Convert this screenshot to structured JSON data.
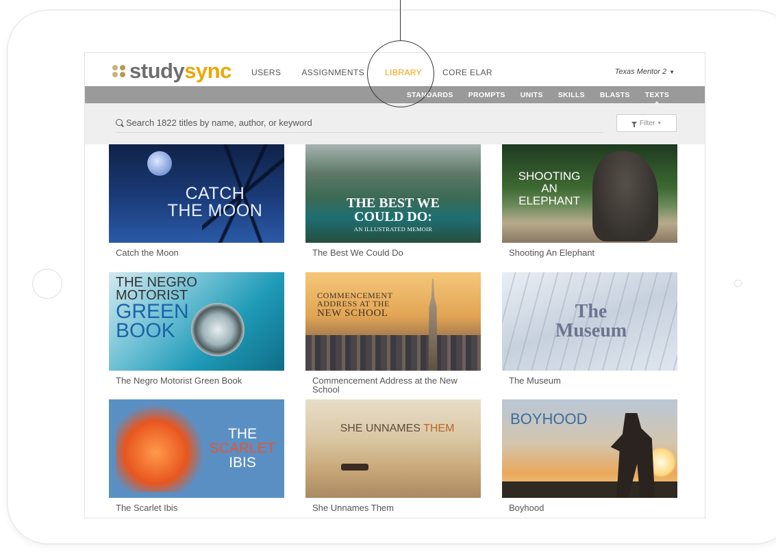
{
  "app": {
    "logo": {
      "prefix": "study",
      "suffix": "sync"
    },
    "nav": [
      "USERS",
      "ASSIGNMENTS",
      "LIBRARY",
      "CORE ELAR"
    ],
    "active_nav": "LIBRARY",
    "user_menu": "Texas Mentor 2",
    "subnav": [
      "STANDARDS",
      "PROMPTS",
      "UNITS",
      "SKILLS",
      "BLASTS",
      "TEXTS"
    ],
    "active_subnav": "TEXTS",
    "search": {
      "placeholder": "Search 1822 titles by name, author, or keyword",
      "value": ""
    },
    "filter_label": "Filter"
  },
  "colors": {
    "accent": "#f2a000",
    "subnav_bg": "#9a9a9a",
    "search_bg": "#efefef"
  },
  "library": [
    {
      "title": "Catch the Moon",
      "cover_lines": [
        "CATCH",
        "THE MOON"
      ]
    },
    {
      "title": "The Best We Could Do",
      "cover_lines": [
        "THE BEST WE",
        "COULD DO:",
        "AN ILLUSTRATED MEMOIR"
      ]
    },
    {
      "title": "Shooting An Elephant",
      "cover_lines": [
        "SHOOTING",
        "AN",
        "ELEPHANT"
      ]
    },
    {
      "title": "The Negro Motorist Green Book",
      "cover_lines": [
        "THE NEGRO",
        "MOTORIST",
        "GREEN",
        "BOOK"
      ]
    },
    {
      "title": "Commencement Address at the New School",
      "cover_lines": [
        "COMMENCEMENT",
        "ADDRESS AT THE",
        "NEW SCHOOL"
      ]
    },
    {
      "title": "The Museum",
      "cover_lines": [
        "The",
        "Museum"
      ]
    },
    {
      "title": "The Scarlet Ibis",
      "cover_lines": [
        "THE",
        "SCARLET",
        "IBIS"
      ]
    },
    {
      "title": "She Unnames Them",
      "cover_lines": [
        "SHE UNNAMES",
        "THEM"
      ]
    },
    {
      "title": "Boyhood",
      "cover_lines": [
        "BOYHOOD"
      ]
    }
  ]
}
